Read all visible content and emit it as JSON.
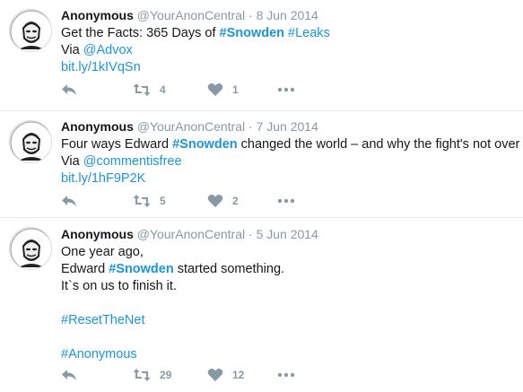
{
  "tweets": [
    {
      "name": "Anonymous",
      "handle": "@YourAnonCentral",
      "date": "8 Jun 2014",
      "line1_pre": "Get the Facts: 365 Days of ",
      "line1_hash1": "#Snowden",
      "line1_hash2": "#Leaks",
      "line2_pre": "Via ",
      "line2_link": "@Advox",
      "line3_link": "bit.ly/1kIVqSn",
      "retweets": "4",
      "likes": "1"
    },
    {
      "name": "Anonymous",
      "handle": "@YourAnonCentral",
      "date": "7 Jun 2014",
      "line1_pre": "Four ways Edward ",
      "line1_hash": "#Snowden",
      "line1_post": " changed the world – and why the fight's not over",
      "line2_pre": "Via ",
      "line2_link": "@commentisfree",
      "line3_link": "bit.ly/1hF9P2K",
      "retweets": "5",
      "likes": "2"
    },
    {
      "name": "Anonymous",
      "handle": "@YourAnonCentral",
      "date": "5 Jun 2014",
      "line1": "One year ago,",
      "line2_pre": "Edward ",
      "line2_hash": "#Snowden",
      "line2_post": " started something.",
      "line3": "It`s on us to finish it.",
      "line4_hash": "#ResetTheNet",
      "line5_hash": "#Anonymous",
      "retweets": "29",
      "likes": "12"
    }
  ],
  "separator": " · ",
  "icons": {
    "avatar": "anonymous-mask-avatar",
    "reply": "reply-icon",
    "retweet": "retweet-icon",
    "like": "heart-icon",
    "more": "more-icon"
  },
  "colors": {
    "link": "#1b95e0",
    "muted": "#8899a6",
    "text": "#14171a",
    "border": "#e6ecf0"
  }
}
